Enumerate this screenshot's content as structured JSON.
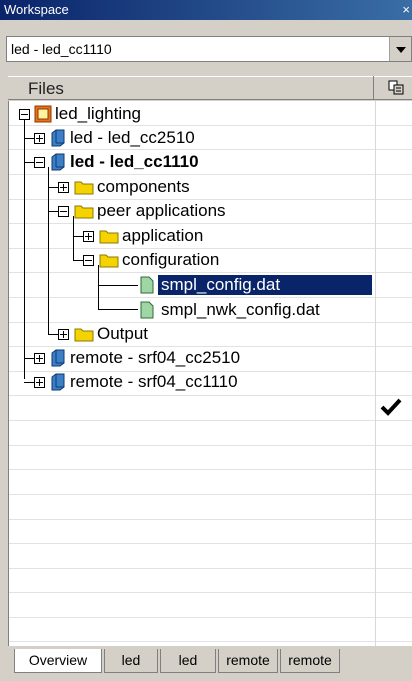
{
  "window": {
    "title": "Workspace",
    "close_glyph": "×"
  },
  "config_combo": {
    "value": "led - led_cc1110"
  },
  "files_panel": {
    "header": "Files"
  },
  "tree": {
    "root": "led_lighting",
    "items": [
      {
        "label": "led - led_cc2510"
      },
      {
        "label": "led - led_cc1110"
      },
      {
        "label": "components"
      },
      {
        "label": "peer applications"
      },
      {
        "label": "application"
      },
      {
        "label": "configuration"
      },
      {
        "label": "smpl_config.dat"
      },
      {
        "label": "smpl_nwk_config.dat"
      },
      {
        "label": "Output"
      },
      {
        "label": "remote - srf04_cc2510"
      },
      {
        "label": "remote - srf04_cc1110"
      }
    ]
  },
  "tabs": [
    {
      "label": "Overview"
    },
    {
      "label": "led"
    },
    {
      "label": "led"
    },
    {
      "label": "remote"
    },
    {
      "label": "remote"
    }
  ],
  "colors": {
    "titlebar": "#0a246a",
    "selection": "#0a246a",
    "folder": "#f5d300",
    "project_icon": "#3c7fc6",
    "file_icon": "#9fd6a5"
  }
}
